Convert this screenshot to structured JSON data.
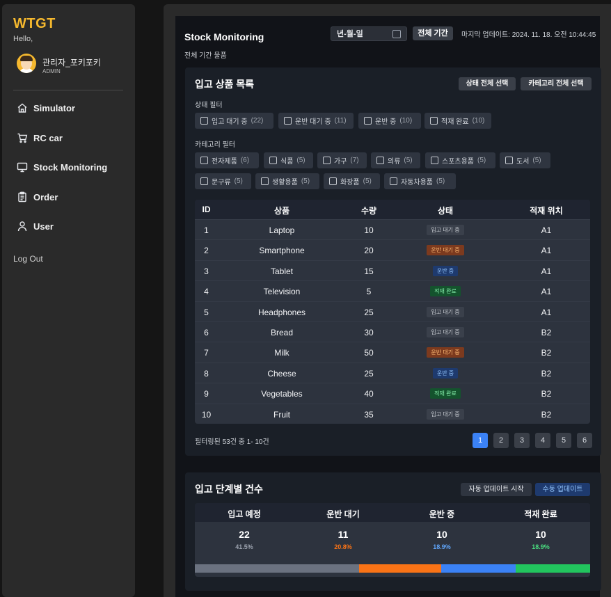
{
  "sidebar": {
    "brand": "WTGT",
    "greeting": "Hello,",
    "user_name": "관리자_포키포키",
    "user_role": "ADMIN",
    "nav": [
      {
        "label": "Simulator",
        "icon": "home-icon"
      },
      {
        "label": "RC car",
        "icon": "cart-icon"
      },
      {
        "label": "Stock Monitoring",
        "icon": "monitor-icon"
      },
      {
        "label": "Order",
        "icon": "clipboard-icon"
      },
      {
        "label": "User",
        "icon": "user-icon"
      }
    ],
    "logout": "Log Out"
  },
  "header": {
    "title": "Stock Monitoring",
    "date_placeholder": "년-월-일",
    "all_period_button": "전체 기간",
    "last_updated": "마지막 업데이트: 2024. 11. 18. 오전 10:44:45",
    "subtitle": "전체 기간 물품"
  },
  "incoming": {
    "title": "입고 상품 목록",
    "select_all_status": "상태 전체 선택",
    "select_all_category": "카테고리 전체 선택",
    "status_filter_label": "상태 필터",
    "status_filters": [
      {
        "label": "입고 대기 중",
        "count": "(22)"
      },
      {
        "label": "운반 대기 중",
        "count": "(11)"
      },
      {
        "label": "운반 중",
        "count": "(10)"
      },
      {
        "label": "적재 완료",
        "count": "(10)"
      }
    ],
    "category_filter_label": "카테고리 필터",
    "category_filters": [
      {
        "label": "전자제품",
        "count": "(6)"
      },
      {
        "label": "식품",
        "count": "(5)"
      },
      {
        "label": "가구",
        "count": "(7)"
      },
      {
        "label": "의류",
        "count": "(5)"
      },
      {
        "label": "스포츠용품",
        "count": "(5)"
      },
      {
        "label": "도서",
        "count": "(5)"
      },
      {
        "label": "문구류",
        "count": "(5)"
      },
      {
        "label": "생활용품",
        "count": "(5)"
      },
      {
        "label": "화장품",
        "count": "(5)"
      },
      {
        "label": "자동차용품",
        "count": "(5)"
      }
    ],
    "columns": [
      "ID",
      "상품",
      "수량",
      "상태",
      "적재 위치"
    ],
    "rows": [
      {
        "id": "1",
        "product": "Laptop",
        "qty": "10",
        "status": "입고 대기 중",
        "status_kind": "waiting",
        "location": "A1"
      },
      {
        "id": "2",
        "product": "Smartphone",
        "qty": "20",
        "status": "운반 대기 중",
        "status_kind": "transport-wait",
        "location": "A1"
      },
      {
        "id": "3",
        "product": "Tablet",
        "qty": "15",
        "status": "운반 중",
        "status_kind": "moving",
        "location": "A1"
      },
      {
        "id": "4",
        "product": "Television",
        "qty": "5",
        "status": "적재 완료",
        "status_kind": "done",
        "location": "A1"
      },
      {
        "id": "5",
        "product": "Headphones",
        "qty": "25",
        "status": "입고 대기 중",
        "status_kind": "waiting",
        "location": "A1"
      },
      {
        "id": "6",
        "product": "Bread",
        "qty": "30",
        "status": "입고 대기 중",
        "status_kind": "waiting",
        "location": "B2"
      },
      {
        "id": "7",
        "product": "Milk",
        "qty": "50",
        "status": "운반 대기 중",
        "status_kind": "transport-wait",
        "location": "B2"
      },
      {
        "id": "8",
        "product": "Cheese",
        "qty": "25",
        "status": "운반 중",
        "status_kind": "moving",
        "location": "B2"
      },
      {
        "id": "9",
        "product": "Vegetables",
        "qty": "40",
        "status": "적재 완료",
        "status_kind": "done",
        "location": "B2"
      },
      {
        "id": "10",
        "product": "Fruit",
        "qty": "35",
        "status": "입고 대기 중",
        "status_kind": "waiting",
        "location": "B2"
      }
    ],
    "footer": "필터링된 53건 중 1- 10건",
    "pages": [
      "1",
      "2",
      "3",
      "4",
      "5",
      "6"
    ],
    "active_page": "1"
  },
  "stages": {
    "title": "입고 단계별 건수",
    "auto_update_button": "자동 업데이트 시작",
    "manual_update_button": "수동 업데이트",
    "items": [
      {
        "label": "입고 예정",
        "count": "22",
        "percent": "41.5%",
        "share": 0.415,
        "color": "#6b7280",
        "pct_color": "#9ca3af"
      },
      {
        "label": "운반 대기",
        "count": "11",
        "percent": "20.8%",
        "share": 0.208,
        "color": "#f97316",
        "pct_color": "#f97316"
      },
      {
        "label": "운반 중",
        "count": "10",
        "percent": "18.9%",
        "share": 0.189,
        "color": "#3b82f6",
        "pct_color": "#60a5fa"
      },
      {
        "label": "적재 완료",
        "count": "10",
        "percent": "18.9%",
        "share": 0.189,
        "color": "#22c55e",
        "pct_color": "#4ade80"
      }
    ]
  },
  "colors": {
    "brand": "#f5b82e",
    "accent": "#3b82f6",
    "status_waiting_bg": "#3a404b",
    "status_transport_wait_bg": "#7c3a1e",
    "status_moving_bg": "#1e3a6e",
    "status_done_bg": "#14532d"
  }
}
